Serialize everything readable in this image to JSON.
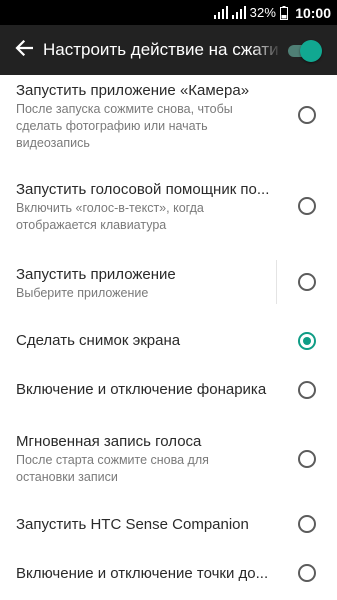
{
  "status_bar": {
    "battery_percent": "32%",
    "time": "10:00"
  },
  "app_bar": {
    "title": "Настроить действие на сжатие",
    "master_switch_on": true,
    "accent_color": "#11a891"
  },
  "options": [
    {
      "title": "Запустить приложение «Камера»",
      "subtitle": "После запуска сожмите снова, чтобы сделать фотографию или начать видеозапись",
      "selected": false
    },
    {
      "title": "Запустить голосовой помощник по...",
      "subtitle": "Включить «голос-в-текст», когда отображается клавиатура",
      "selected": false
    },
    {
      "title": "Запустить приложение",
      "subtitle": "Выберите приложение",
      "selected": false
    },
    {
      "title": "Сделать снимок экрана",
      "subtitle": "",
      "selected": true
    },
    {
      "title": "Включение и отключение фонарика",
      "subtitle": "",
      "selected": false
    },
    {
      "title": "Мгновенная запись голоса",
      "subtitle": "После старта сожмите снова для остановки записи",
      "selected": false
    },
    {
      "title": "Запустить HTC Sense Companion",
      "subtitle": "",
      "selected": false
    },
    {
      "title": "Включение и отключение точки до...",
      "subtitle": "",
      "selected": false
    }
  ]
}
